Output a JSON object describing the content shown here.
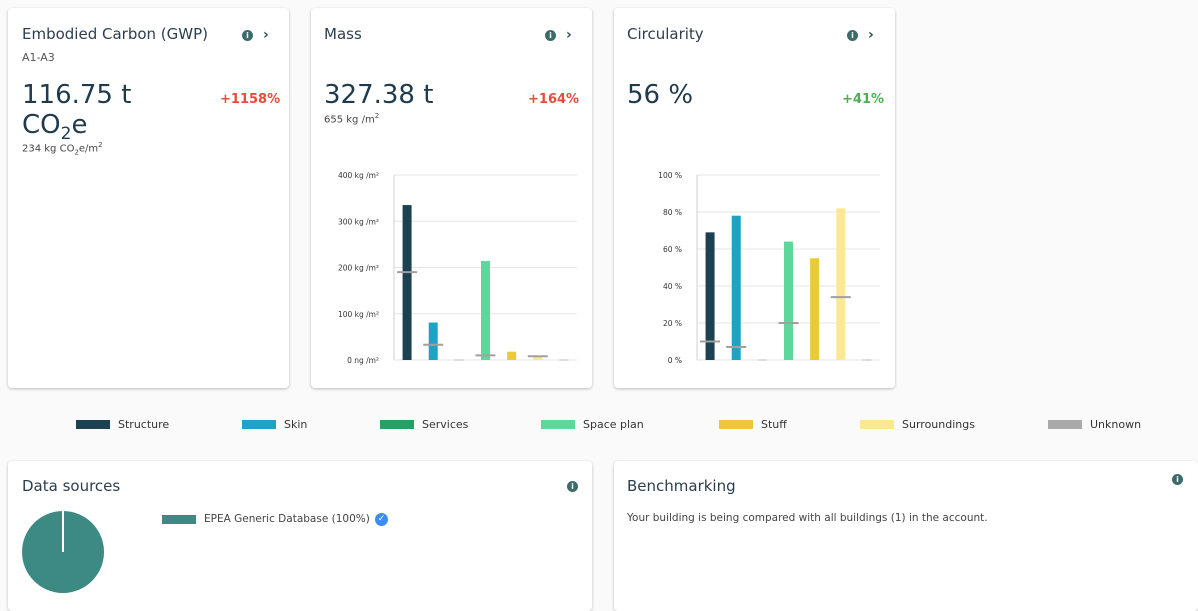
{
  "colors": {
    "structure": "#1c4150",
    "skin": "#1ea3c4",
    "services": "#27a065",
    "space_plan": "#5ed89a",
    "stuff": "#ecc83b",
    "surroundings": "#fbe893",
    "unknown": "#aaaaaa",
    "increase": "#e74c3c",
    "decrease": "#4caf50",
    "accent": "#3d8a85"
  },
  "cards": {
    "carbon": {
      "title": "Embodied Carbon (GWP)",
      "subtitle": "A1-A3",
      "value_line1": "116.75 t",
      "value_line2_base": "CO",
      "value_line2_sub": "2",
      "value_line2_end": "e",
      "change": "+1158%",
      "per_area_pre": "234 kg CO",
      "per_area_sub": "2",
      "per_area_mid": "e/m",
      "per_area_sup": "2"
    },
    "mass": {
      "title": "Mass",
      "value": "327.38 t",
      "change": "+164%",
      "per_area_pre": "655 kg /m",
      "per_area_sup": "2"
    },
    "circularity": {
      "title": "Circularity",
      "value": "56 %",
      "change": "+41%"
    }
  },
  "info_icon": "info-icon",
  "chevron_icon": "chevron-right-icon",
  "chart_data": [
    {
      "type": "bar",
      "title": "Mass",
      "categories": [
        "Structure",
        "Skin",
        "Services",
        "Space plan",
        "Stuff",
        "Surroundings",
        "Unknown"
      ],
      "values": [
        335,
        81,
        0,
        214,
        18,
        8,
        0
      ],
      "benchmark_markers": [
        190,
        33,
        null,
        10,
        null,
        8,
        null
      ],
      "yticks": [
        "0 ng /m²",
        "100 kg /m²",
        "200 kg /m²",
        "300 kg /m²",
        "400 kg /m²"
      ],
      "ylim": [
        0,
        400
      ],
      "grid": true
    },
    {
      "type": "bar",
      "title": "Circularity",
      "categories": [
        "Structure",
        "Skin",
        "Services",
        "Space plan",
        "Stuff",
        "Surroundings",
        "Unknown"
      ],
      "values": [
        69,
        78,
        0,
        64,
        55,
        82,
        0
      ],
      "benchmark_markers": [
        10,
        7,
        null,
        20,
        null,
        34,
        null
      ],
      "yticks": [
        "0 %",
        "20 %",
        "40 %",
        "60 %",
        "80 %",
        "100 %"
      ],
      "ylim": [
        0,
        100
      ],
      "grid": true
    }
  ],
  "legend": [
    {
      "label": "Structure",
      "key": "structure"
    },
    {
      "label": "Skin",
      "key": "skin"
    },
    {
      "label": "Services",
      "key": "services"
    },
    {
      "label": "Space plan",
      "key": "space_plan"
    },
    {
      "label": "Stuff",
      "key": "stuff"
    },
    {
      "label": "Surroundings",
      "key": "surroundings"
    },
    {
      "label": "Unknown",
      "key": "unknown"
    }
  ],
  "data_sources": {
    "title": "Data sources",
    "items": [
      {
        "label": "EPEA Generic Database (100%)",
        "share": 1.0,
        "verified_icon": "verified-check-icon"
      }
    ]
  },
  "benchmarking": {
    "title": "Benchmarking",
    "text": "Your building is being compared with all buildings (1) in the account."
  }
}
